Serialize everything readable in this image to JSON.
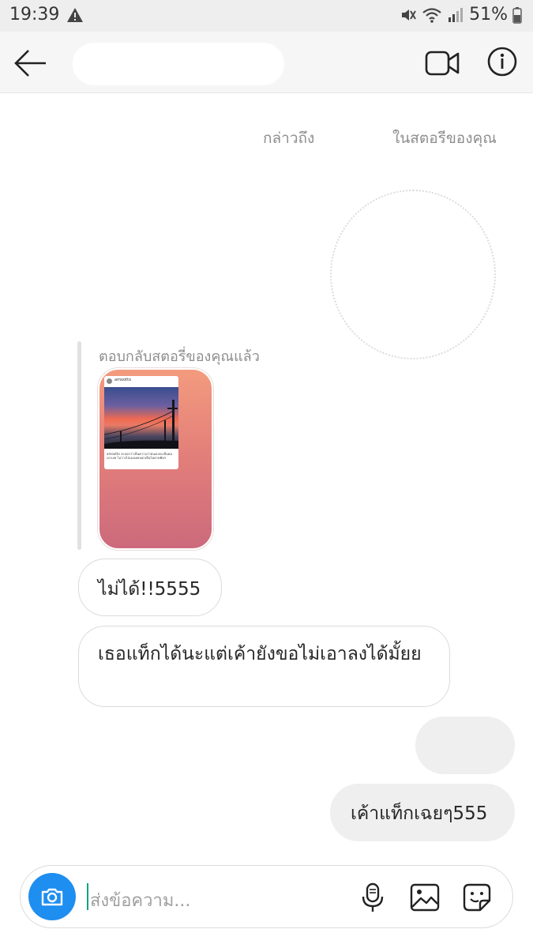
{
  "status_bar": {
    "time": "19:39",
    "battery": "51%",
    "icons": [
      "alert-icon",
      "mute-icon",
      "wifi-icon",
      "signal-icon",
      "battery-icon"
    ]
  },
  "header": {
    "icons": [
      "back-arrow-icon",
      "video-call-icon",
      "info-icon"
    ]
  },
  "thread": {
    "mention_left": "กล่าวถึง",
    "mention_right": "ในสตอรีของคุณ",
    "story_reply_label": "ตอบกลับสตอรี่ของคุณแล้ว",
    "story_preview": {
      "username": "amootto",
      "caption": "amootto จะบอกว่าเห็นความว่าตนเองจะเห็นคมเบาเลย ไม่ว่างไปเองเคยบอกเห็นไม่คาดคิดฯ"
    },
    "messages": [
      {
        "from": "them",
        "text": "ไม่ได้!!5555"
      },
      {
        "from": "them",
        "text": "เธอแท็กได้นะแต่เค้ายังขอไม่เอาลงได้มั้ยย"
      },
      {
        "from": "me",
        "text": ""
      },
      {
        "from": "me",
        "text": "เค้าแท็กเฉยๆ555"
      }
    ]
  },
  "composer": {
    "placeholder": "ส่งข้อความ...",
    "icons": [
      "camera-icon",
      "microphone-icon",
      "gallery-icon",
      "sticker-icon"
    ]
  },
  "colors": {
    "accent": "#1e8ef0",
    "bubble_mine": "#efefef",
    "bubble_border": "#dbdbdb",
    "muted_text": "#8e8e8e"
  }
}
